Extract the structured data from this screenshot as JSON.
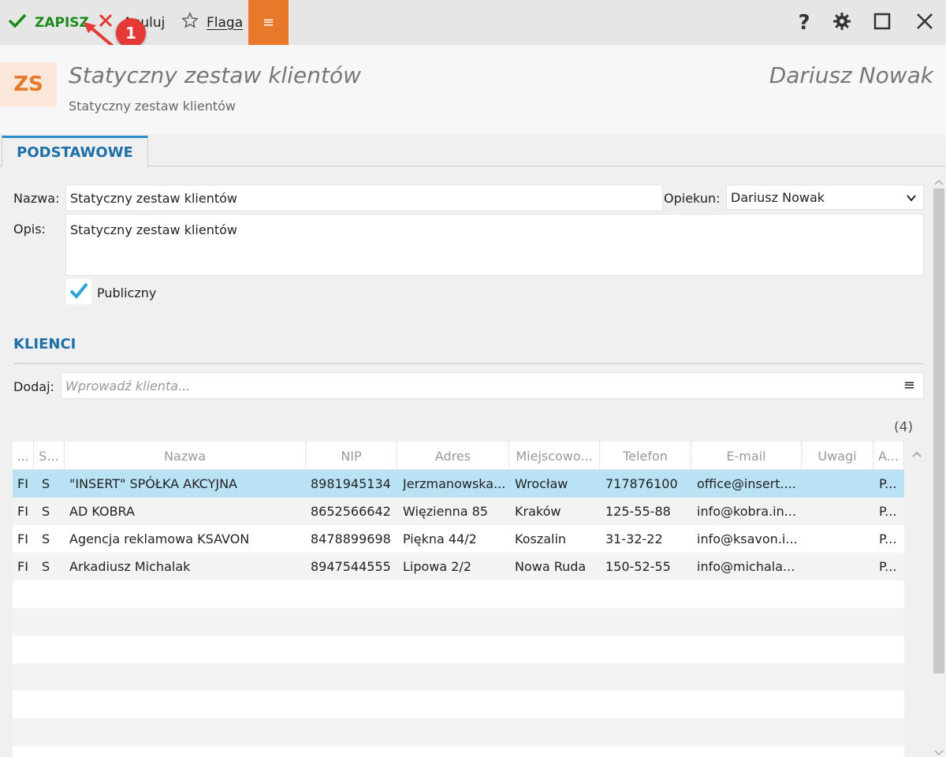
{
  "toolbar": {
    "save_label": "ZAPISZ",
    "cancel_label": "Anuluj",
    "flag_label": "Flaga",
    "menu_glyph": "≡",
    "help_glyph": "?"
  },
  "annotation": {
    "badge": "1"
  },
  "header": {
    "avatar_initials": "ZS",
    "title": "Statyczny zestaw klientów",
    "subtitle": "Statyczny zestaw klientów",
    "owner": "Dariusz Nowak"
  },
  "tabs": [
    {
      "label": "PODSTAWOWE"
    }
  ],
  "form": {
    "name_label": "Nazwa:",
    "name_value": "Statyczny zestaw klientów",
    "caretaker_label": "Opiekun:",
    "caretaker_value": "Dariusz Nowak",
    "description_label": "Opis:",
    "description_value": "Statyczny zestaw klientów",
    "public_label": "Publiczny",
    "public_checked": true
  },
  "clients": {
    "section_title": "KLIENCI",
    "add_label": "Dodaj:",
    "add_placeholder": "Wprowadź klienta...",
    "menu_glyph": "≡",
    "count": "(4)",
    "columns": [
      "...",
      "S...",
      "Nazwa",
      "NIP",
      "Adres",
      "Miejscowo...",
      "Telefon",
      "E-mail",
      "Uwagi",
      "A..."
    ],
    "rows": [
      [
        "FI",
        "S",
        "\"INSERT\" SPÓŁKA AKCYJNA",
        "8981945134",
        "Jerzmanowska...",
        "Wrocław",
        "717876100",
        "office@insert....",
        "",
        "P..."
      ],
      [
        "FI",
        "S",
        "AD KOBRA",
        "8652566642",
        "Więzienna 85",
        "Kraków",
        "125-55-88",
        "info@kobra.in...",
        "",
        "P..."
      ],
      [
        "FI",
        "S",
        "Agencja reklamowa KSAVON",
        "8478899698",
        "Piękna  44/2",
        "Koszalin",
        "31-32-22",
        "info@ksavon.i...",
        "",
        "P..."
      ],
      [
        "FI",
        "S",
        "Arkadiusz Michalak",
        "8947544555",
        "Lipowa  2/2",
        "Nowa Ruda",
        "150-52-55",
        "info@michala...",
        "",
        "P..."
      ]
    ],
    "selected_row": 0
  },
  "colors": {
    "accent": "#e8792b",
    "primary_blue": "#1d6fa8",
    "save_green": "#1a8a1a",
    "selected_row": "#b9e2f5",
    "annotation_red": "#e53935"
  }
}
